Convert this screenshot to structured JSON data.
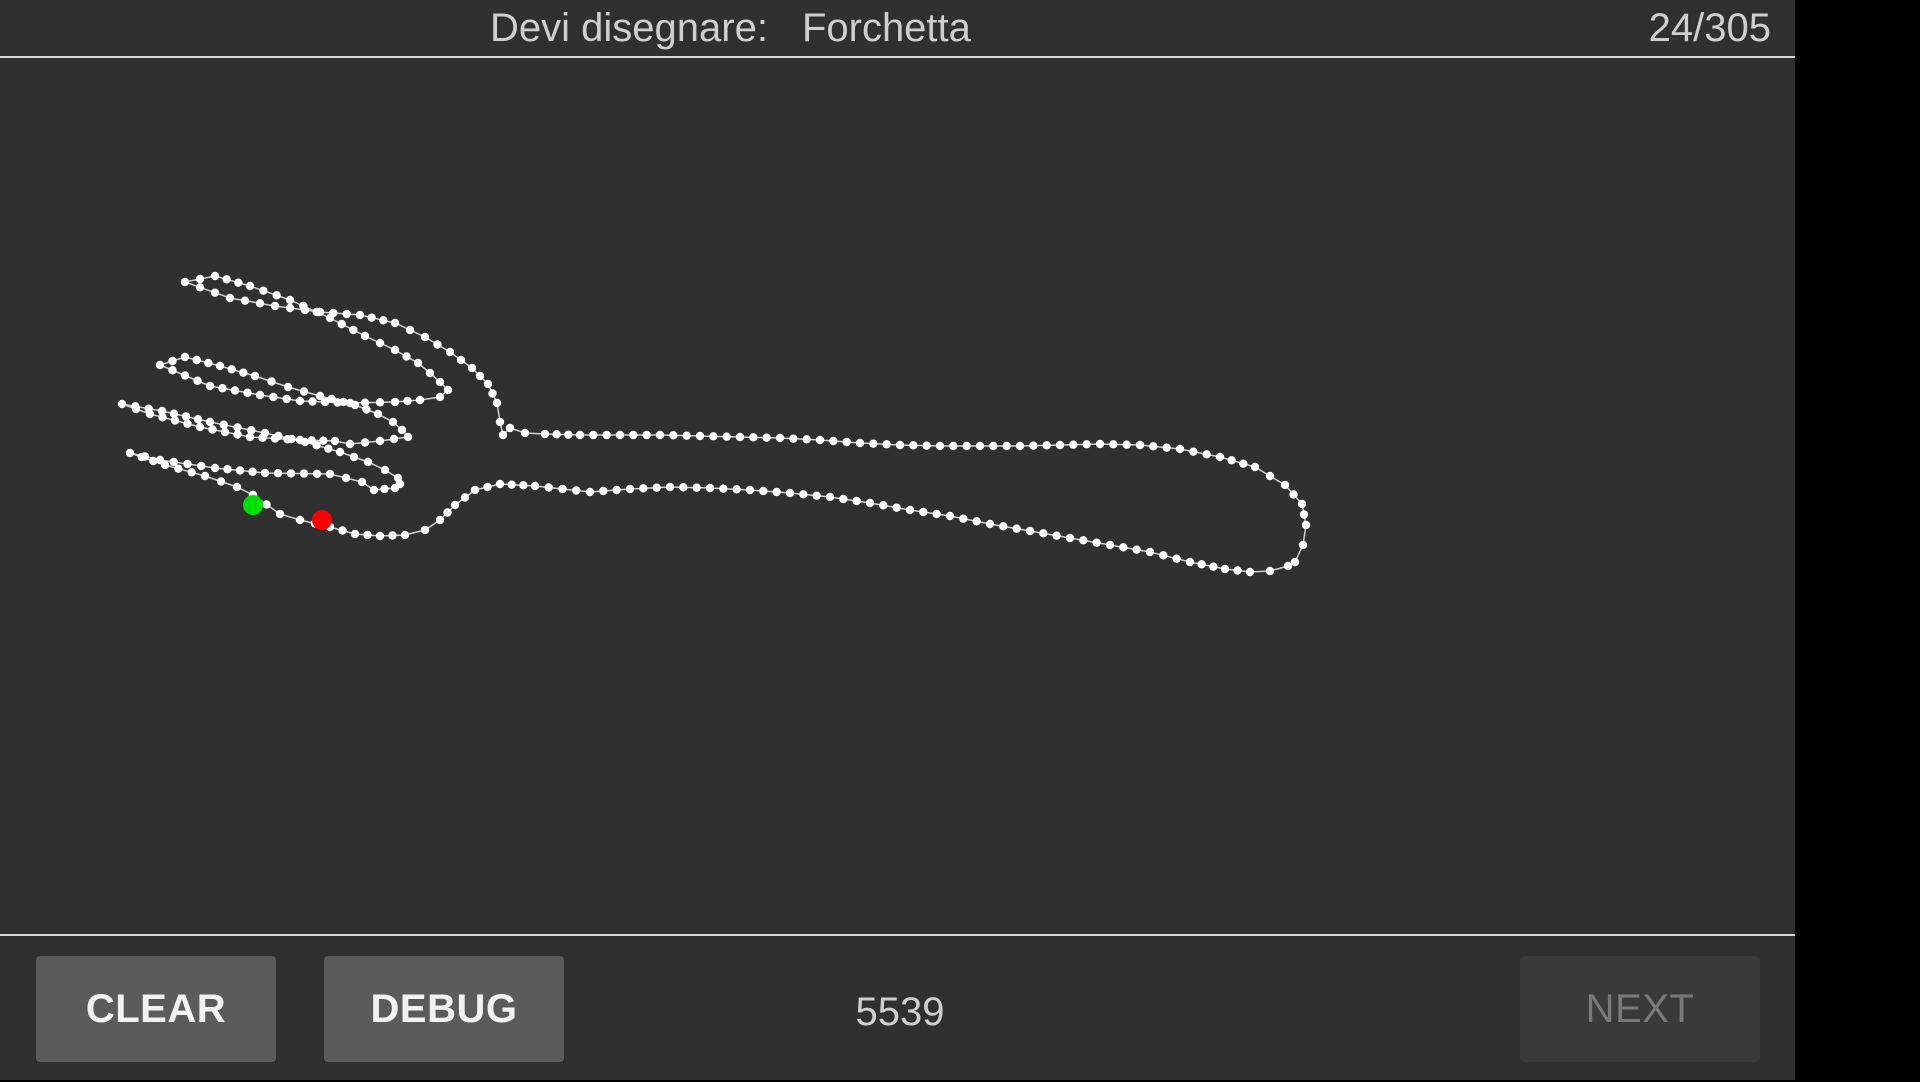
{
  "header": {
    "prompt_label": "Devi disegnare:",
    "prompt_word": "Forchetta",
    "progress": "24/305"
  },
  "footer": {
    "clear_label": "CLEAR",
    "debug_label": "DEBUG",
    "score": "5539",
    "next_label": "NEXT",
    "next_enabled": false
  },
  "drawing": {
    "subject": "fork",
    "stroke_color": "#ffffff",
    "start_marker_color": "#00e000",
    "end_marker_color": "#ff0000"
  },
  "colors": {
    "background": "#303030",
    "button": "#5b5b5c",
    "button_disabled": "#3a3a3a",
    "divider": "#d9d9d9"
  }
}
